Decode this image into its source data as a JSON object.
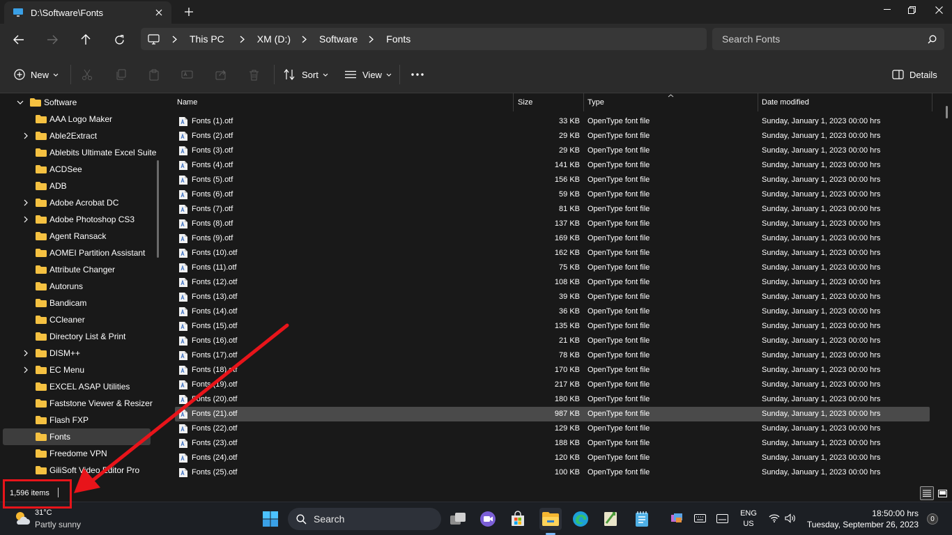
{
  "window": {
    "tab_title": "D:\\Software\\Fonts"
  },
  "address": {
    "crumbs": [
      "This PC",
      "XM (D:)",
      "Software",
      "Fonts"
    ]
  },
  "search": {
    "placeholder": "Search Fonts"
  },
  "commandbar": {
    "new_label": "New",
    "sort_label": "Sort",
    "view_label": "View",
    "details_label": "Details"
  },
  "sidebar": {
    "root": "Software",
    "items": [
      {
        "label": "AAA Logo Maker",
        "expandable": false
      },
      {
        "label": "Able2Extract",
        "expandable": true
      },
      {
        "label": "Ablebits Ultimate Excel Suite",
        "expandable": false
      },
      {
        "label": "ACDSee",
        "expandable": false
      },
      {
        "label": "ADB",
        "expandable": false
      },
      {
        "label": "Adobe Acrobat DC",
        "expandable": true
      },
      {
        "label": "Adobe Photoshop CS3",
        "expandable": true
      },
      {
        "label": "Agent Ransack",
        "expandable": false
      },
      {
        "label": "AOMEI Partition Assistant",
        "expandable": false
      },
      {
        "label": "Attribute Changer",
        "expandable": false
      },
      {
        "label": "Autoruns",
        "expandable": false
      },
      {
        "label": "Bandicam",
        "expandable": false
      },
      {
        "label": "CCleaner",
        "expandable": false
      },
      {
        "label": "Directory List & Print",
        "expandable": false
      },
      {
        "label": "DISM++",
        "expandable": true
      },
      {
        "label": "EC Menu",
        "expandable": true
      },
      {
        "label": "EXCEL ASAP Utilities",
        "expandable": false
      },
      {
        "label": "Faststone Viewer & Resizer",
        "expandable": false
      },
      {
        "label": "Flash FXP",
        "expandable": false
      },
      {
        "label": "Fonts",
        "expandable": false,
        "selected": true
      },
      {
        "label": "Freedome VPN",
        "expandable": false
      },
      {
        "label": "GiliSoft Video Editor Pro",
        "expandable": false
      }
    ]
  },
  "columns": {
    "name": "Name",
    "size": "Size",
    "type": "Type",
    "date": "Date modified"
  },
  "files": [
    {
      "name": "Fonts (1).otf",
      "size": "33 KB",
      "type": "OpenType font file",
      "date": "Sunday, January 1, 2023 00:00 hrs"
    },
    {
      "name": "Fonts (2).otf",
      "size": "29 KB",
      "type": "OpenType font file",
      "date": "Sunday, January 1, 2023 00:00 hrs"
    },
    {
      "name": "Fonts (3).otf",
      "size": "29 KB",
      "type": "OpenType font file",
      "date": "Sunday, January 1, 2023 00:00 hrs"
    },
    {
      "name": "Fonts (4).otf",
      "size": "141 KB",
      "type": "OpenType font file",
      "date": "Sunday, January 1, 2023 00:00 hrs"
    },
    {
      "name": "Fonts (5).otf",
      "size": "156 KB",
      "type": "OpenType font file",
      "date": "Sunday, January 1, 2023 00:00 hrs"
    },
    {
      "name": "Fonts (6).otf",
      "size": "59 KB",
      "type": "OpenType font file",
      "date": "Sunday, January 1, 2023 00:00 hrs"
    },
    {
      "name": "Fonts (7).otf",
      "size": "81 KB",
      "type": "OpenType font file",
      "date": "Sunday, January 1, 2023 00:00 hrs"
    },
    {
      "name": "Fonts (8).otf",
      "size": "137 KB",
      "type": "OpenType font file",
      "date": "Sunday, January 1, 2023 00:00 hrs"
    },
    {
      "name": "Fonts (9).otf",
      "size": "169 KB",
      "type": "OpenType font file",
      "date": "Sunday, January 1, 2023 00:00 hrs"
    },
    {
      "name": "Fonts (10).otf",
      "size": "162 KB",
      "type": "OpenType font file",
      "date": "Sunday, January 1, 2023 00:00 hrs"
    },
    {
      "name": "Fonts (11).otf",
      "size": "75 KB",
      "type": "OpenType font file",
      "date": "Sunday, January 1, 2023 00:00 hrs"
    },
    {
      "name": "Fonts (12).otf",
      "size": "108 KB",
      "type": "OpenType font file",
      "date": "Sunday, January 1, 2023 00:00 hrs"
    },
    {
      "name": "Fonts (13).otf",
      "size": "39 KB",
      "type": "OpenType font file",
      "date": "Sunday, January 1, 2023 00:00 hrs"
    },
    {
      "name": "Fonts (14).otf",
      "size": "36 KB",
      "type": "OpenType font file",
      "date": "Sunday, January 1, 2023 00:00 hrs"
    },
    {
      "name": "Fonts (15).otf",
      "size": "135 KB",
      "type": "OpenType font file",
      "date": "Sunday, January 1, 2023 00:00 hrs"
    },
    {
      "name": "Fonts (16).otf",
      "size": "21 KB",
      "type": "OpenType font file",
      "date": "Sunday, January 1, 2023 00:00 hrs"
    },
    {
      "name": "Fonts (17).otf",
      "size": "78 KB",
      "type": "OpenType font file",
      "date": "Sunday, January 1, 2023 00:00 hrs"
    },
    {
      "name": "Fonts (18).otf",
      "size": "170 KB",
      "type": "OpenType font file",
      "date": "Sunday, January 1, 2023 00:00 hrs"
    },
    {
      "name": "Fonts (19).otf",
      "size": "217 KB",
      "type": "OpenType font file",
      "date": "Sunday, January 1, 2023 00:00 hrs"
    },
    {
      "name": "Fonts (20).otf",
      "size": "180 KB",
      "type": "OpenType font file",
      "date": "Sunday, January 1, 2023 00:00 hrs"
    },
    {
      "name": "Fonts (21).otf",
      "size": "987 KB",
      "type": "OpenType font file",
      "date": "Sunday, January 1, 2023 00:00 hrs",
      "selected": true
    },
    {
      "name": "Fonts (22).otf",
      "size": "129 KB",
      "type": "OpenType font file",
      "date": "Sunday, January 1, 2023 00:00 hrs"
    },
    {
      "name": "Fonts (23).otf",
      "size": "188 KB",
      "type": "OpenType font file",
      "date": "Sunday, January 1, 2023 00:00 hrs"
    },
    {
      "name": "Fonts (24).otf",
      "size": "120 KB",
      "type": "OpenType font file",
      "date": "Sunday, January 1, 2023 00:00 hrs"
    },
    {
      "name": "Fonts (25).otf",
      "size": "100 KB",
      "type": "OpenType font file",
      "date": "Sunday, January 1, 2023 00:00 hrs"
    }
  ],
  "status": {
    "item_count": "1,596 items"
  },
  "taskbar": {
    "weather_temp": "31°C",
    "weather_desc": "Partly sunny",
    "search_label": "Search",
    "lang_line1": "ENG",
    "lang_line2": "US",
    "clock_time": "18:50:00 hrs",
    "clock_date": "Tuesday, September 26, 2023",
    "notification_count": "0"
  },
  "colors": {
    "annotation": "#e8141a",
    "folder": "#f5c141",
    "accent": "#7ab8f5"
  }
}
